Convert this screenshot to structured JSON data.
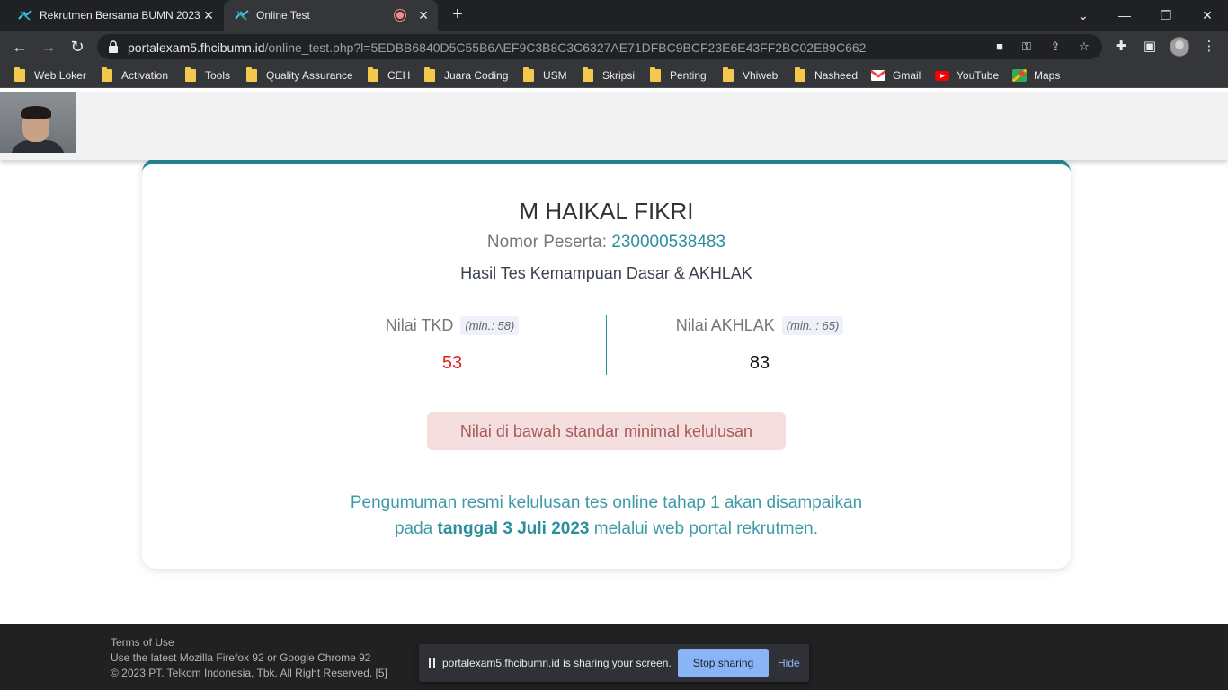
{
  "browser": {
    "tabs": [
      {
        "title": "Rekrutmen Bersama BUMN 2023",
        "active": false
      },
      {
        "title": "Online Test",
        "active": true,
        "recording": true
      }
    ],
    "new_tab": "+",
    "window_controls": {
      "minimize": "—",
      "restore": "❐",
      "close": "✕",
      "tab_list": "⌄"
    },
    "url": {
      "host": "portalexam5.fhcibumn.id",
      "path": "/online_test.php?l=5EDBB6840D5C55B6AEF9C3B8C3C6327AE71DFBC9BCF23E6E43FF2BC02E89C662"
    },
    "bookmarks": [
      {
        "label": "Web Loker",
        "icon": "folder-icon"
      },
      {
        "label": "Activation",
        "icon": "folder-icon"
      },
      {
        "label": "Tools",
        "icon": "folder-icon"
      },
      {
        "label": "Quality Assurance",
        "icon": "folder-icon"
      },
      {
        "label": "CEH",
        "icon": "folder-icon"
      },
      {
        "label": "Juara Coding",
        "icon": "folder-icon"
      },
      {
        "label": "USM",
        "icon": "folder-icon"
      },
      {
        "label": "Skripsi",
        "icon": "folder-icon"
      },
      {
        "label": "Penting",
        "icon": "folder-icon"
      },
      {
        "label": "Vhiweb",
        "icon": "folder-icon"
      },
      {
        "label": "Nasheed",
        "icon": "folder-icon"
      },
      {
        "label": "Gmail",
        "icon": "gmail-icon"
      },
      {
        "label": "YouTube",
        "icon": "youtube-icon"
      },
      {
        "label": "Maps",
        "icon": "maps-icon"
      }
    ]
  },
  "result": {
    "name": "M HAIKAL FIKRI",
    "peserta_label": "Nomor Peserta: ",
    "peserta_number": "230000538483",
    "subtitle": "Hasil Tes Kemampuan Dasar & AKHLAK",
    "tkd": {
      "label": "Nilai TKD",
      "min": "(min.: 58)",
      "value": "53"
    },
    "akhlak": {
      "label": "Nilai AKHLAK",
      "min": "(min. : 65)",
      "value": "83"
    },
    "alert": "Nilai di bawah standar minimal kelulusan",
    "announce_line1": "Pengumuman resmi kelulusan tes online tahap 1 akan disampaikan",
    "announce_pre": "pada ",
    "announce_date": "tanggal 3 Juli 2023",
    "announce_post": " melalui web portal rekrutmen."
  },
  "footer": {
    "terms": "Terms of Use",
    "browser_note": "Use the latest Mozilla Firefox 92 or Google Chrome 92",
    "copyright": "© 2023 PT. Telkom Indonesia, Tbk. All Right Reserved. [5]"
  },
  "share_bar": {
    "message": "portalexam5.fhcibumn.id is sharing your screen.",
    "stop": "Stop sharing",
    "hide": "Hide"
  },
  "colors": {
    "accent": "#2a8f9c",
    "fail": "#e02020",
    "alert_bg": "#f5dede"
  }
}
